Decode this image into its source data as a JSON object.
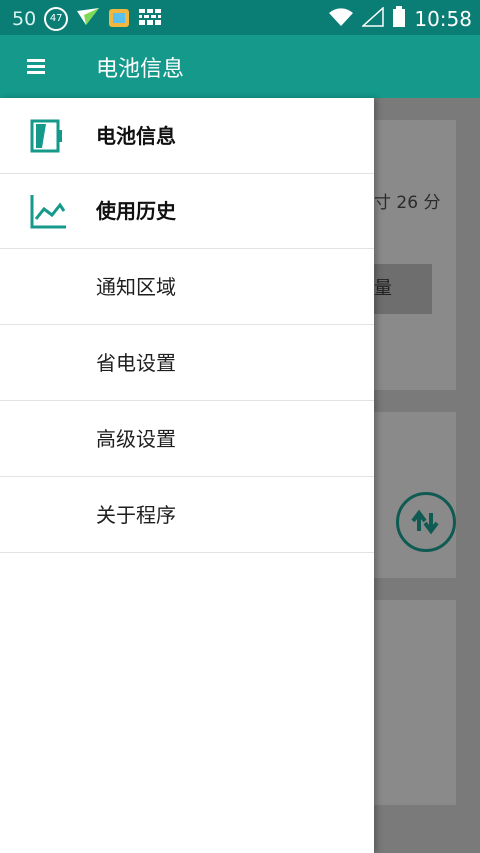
{
  "statusbar": {
    "left_number": "50",
    "notif_badge": "47",
    "time": "10:58"
  },
  "toolbar": {
    "title": "电池信息"
  },
  "drawer": {
    "items": [
      {
        "label": "电池信息",
        "icon": "battery-icon"
      },
      {
        "label": "使用历史",
        "icon": "chart-icon"
      },
      {
        "label": "通知区域"
      },
      {
        "label": "省电设置"
      },
      {
        "label": "高级设置"
      },
      {
        "label": "关于程序"
      }
    ]
  },
  "background": {
    "text_fragment": "寸 26 分",
    "button_fragment": "量"
  },
  "colors": {
    "toolbar": "#14998b",
    "statusbar": "#0a7d74",
    "accent_icon": "#14998b"
  }
}
